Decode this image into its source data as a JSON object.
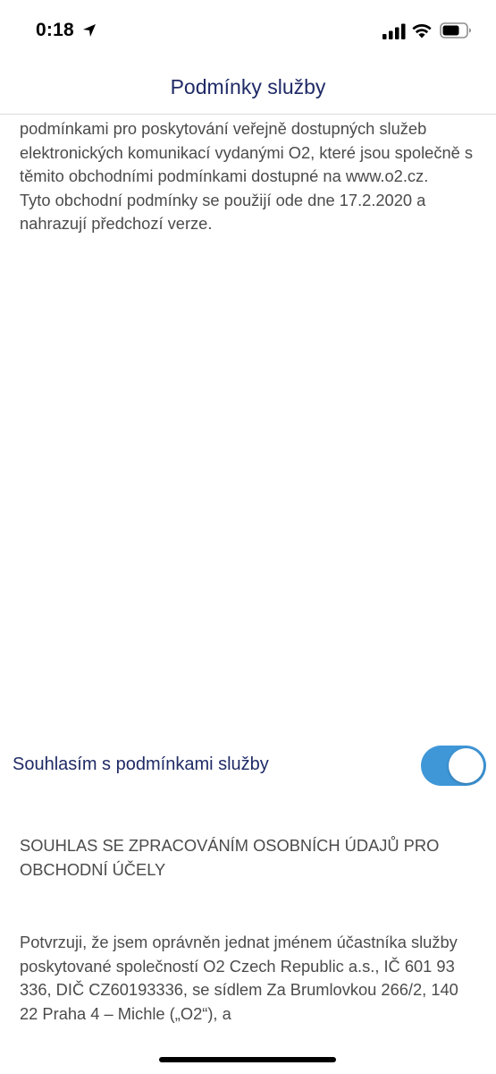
{
  "status_bar": {
    "time": "0:18",
    "location_icon": "location-arrow-icon",
    "signal_icon": "cellular-signal-icon",
    "wifi_icon": "wifi-icon",
    "battery_icon": "battery-icon"
  },
  "nav": {
    "title": "Podmínky služby"
  },
  "terms": {
    "paragraph_1": "podmínkami pro poskytování veřejně dostupných služeb elektronických komunikací vydanými O2, které jsou společně s těmito obchodními podmínkami dostupné na www.o2.cz.",
    "paragraph_2": "Tyto obchodní podmínky se použijí ode dne 17.2.2020 a nahrazují předchozí verze."
  },
  "consent": {
    "label": "Souhlasím s podmínkami služby",
    "toggle_on": true,
    "toggle_color": "#3f97d8"
  },
  "personal_data": {
    "heading": "SOUHLAS SE ZPRACOVÁNÍM OSOBNÍCH ÚDAJŮ PRO OBCHODNÍ ÚČELY",
    "body": "Potvrzuji, že jsem oprávněn jednat jménem účastníka služby poskytované společností O2 Czech Republic a.s., IČ 601 93 336, DIČ CZ60193336, se sídlem Za Brumlovkou 266/2, 140 22 Praha 4 – Michle („O2“), a"
  },
  "colors": {
    "brand_navy": "#1f2a66",
    "body_text": "#4b4b4b"
  }
}
